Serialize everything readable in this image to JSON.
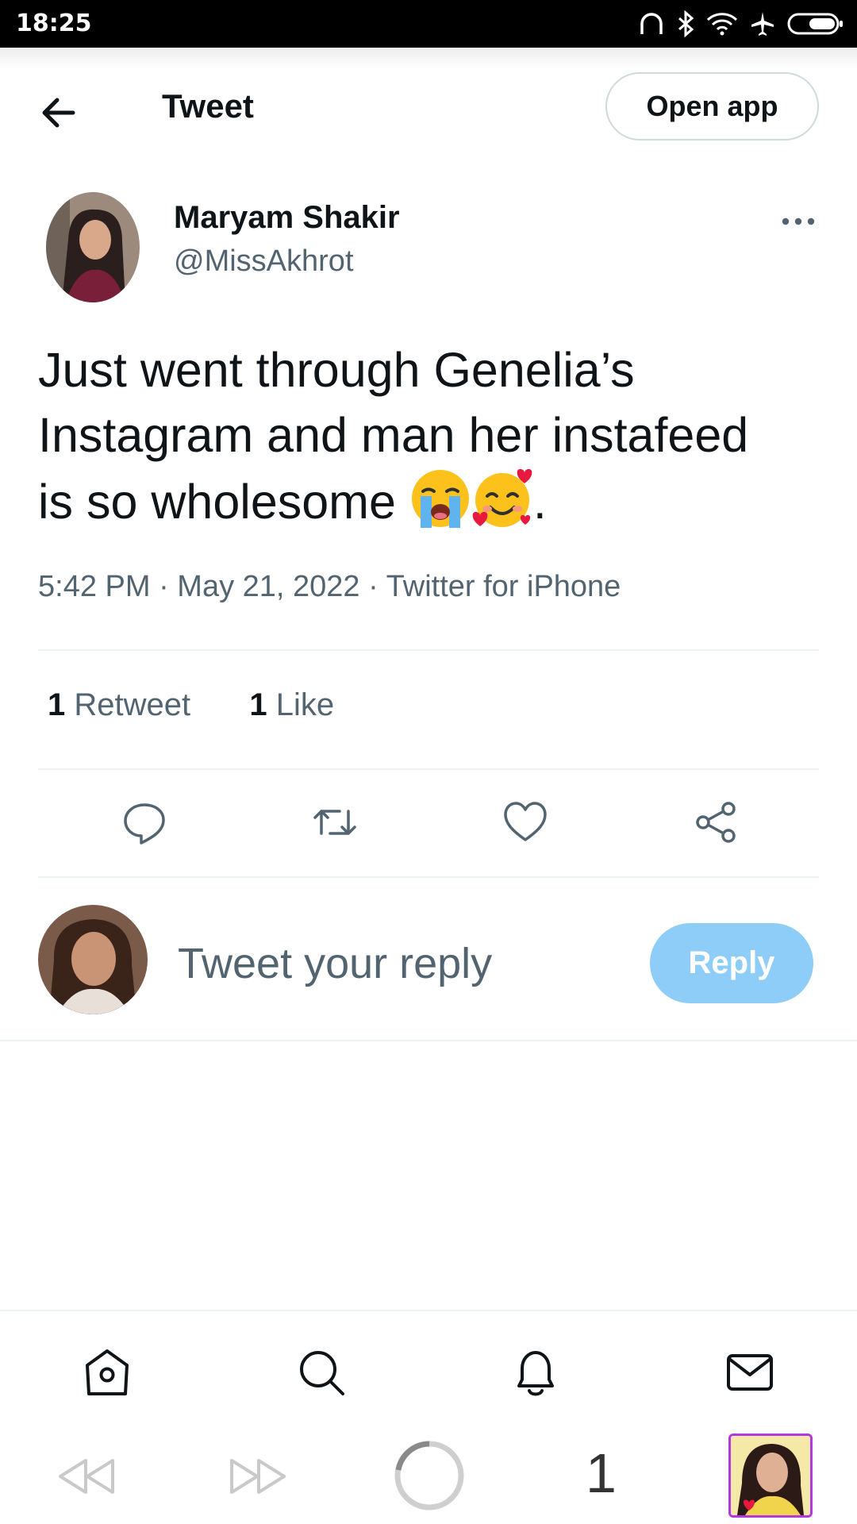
{
  "status_bar": {
    "time": "18:25",
    "icons": [
      "headphones-icon",
      "bluetooth-icon",
      "wifi-icon",
      "airplane-icon",
      "battery-icon"
    ]
  },
  "header": {
    "title": "Tweet",
    "open_app_label": "Open app"
  },
  "tweet": {
    "author_name": "Maryam Shakir",
    "author_handle": "@MissAkhrot",
    "text_line1": "Just went through Genelia’s",
    "text_line2": "Instagram and man her instafeed",
    "text_line3": "is so wholesome",
    "text_end": ".",
    "emojis": [
      "loudly-crying-face",
      "smiling-face-with-hearts"
    ],
    "meta": "5:42 PM · May 21, 2022 · Twitter for iPhone"
  },
  "stats": {
    "retweet_count": "1",
    "retweet_label": "Retweet",
    "like_count": "1",
    "like_label": "Like"
  },
  "actions": [
    "reply-icon",
    "retweet-icon",
    "like-icon",
    "share-icon"
  ],
  "reply": {
    "placeholder": "Tweet your reply",
    "button_label": "Reply"
  },
  "bottom_nav": [
    "home-icon",
    "search-icon",
    "notifications-icon",
    "messages-icon"
  ],
  "browser_bar": {
    "tab_count": "1"
  },
  "colors": {
    "text_primary": "#0f1419",
    "text_secondary": "#536471",
    "reply_button": "#8ecdf8",
    "divider": "#eff3f4"
  }
}
